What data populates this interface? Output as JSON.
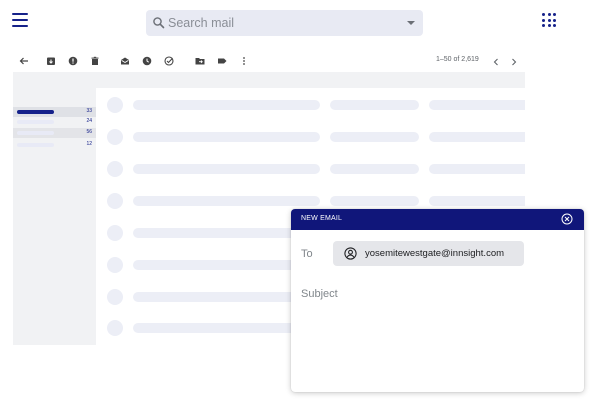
{
  "search": {
    "placeholder": "Search mail",
    "value": ""
  },
  "toolbar": {
    "actions": [
      "back-icon",
      "archive-icon",
      "report-spam-icon",
      "delete-icon",
      "mark-unread-icon",
      "snooze-icon",
      "add-task-icon",
      "move-to-icon",
      "label-icon",
      "more-options-icon"
    ],
    "pagination": "1–50 of 2,619"
  },
  "sidebar": {
    "counts": [
      "33",
      "24",
      "56",
      "12"
    ]
  },
  "compose": {
    "title": "NEW EMAIL",
    "to_label": "To",
    "recipient": "yosemitewestgate@innsight.com",
    "subject_placeholder": "Subject",
    "subject_value": ""
  },
  "colors": {
    "brand": "#16228a",
    "compose_header": "#10167a",
    "skeleton": "#eceef6",
    "panel": "#f1f2f4",
    "search_bg": "#e8eaf3"
  }
}
